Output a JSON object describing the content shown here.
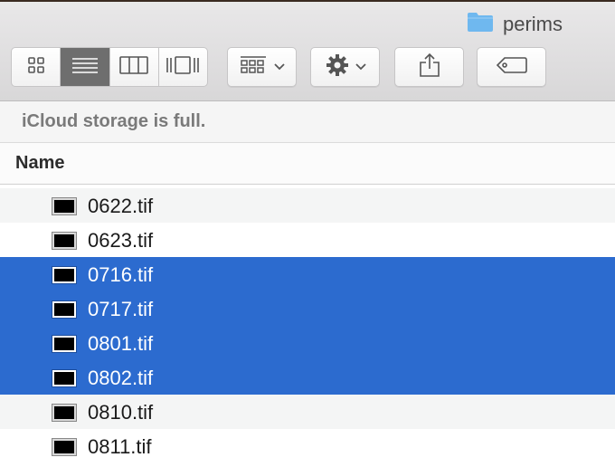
{
  "window": {
    "title": "perims",
    "title_icon": "folder-icon"
  },
  "toolbar": {
    "view_modes": [
      {
        "name": "icon-view",
        "icon": "grid-icon",
        "active": false
      },
      {
        "name": "list-view",
        "icon": "list-icon",
        "active": true
      },
      {
        "name": "column-view",
        "icon": "columns-icon",
        "active": false
      },
      {
        "name": "cover-flow-view",
        "icon": "coverflow-icon",
        "active": false
      }
    ],
    "arrange_icon": "arrange-icon",
    "action_icon": "gear-icon",
    "share_icon": "share-icon",
    "tags_icon": "tag-icon"
  },
  "banner": {
    "text": "iCloud storage is full."
  },
  "list": {
    "column_header": "Name",
    "files": [
      {
        "name": "0622.tif",
        "selected": false
      },
      {
        "name": "0623.tif",
        "selected": false
      },
      {
        "name": "0716.tif",
        "selected": true
      },
      {
        "name": "0717.tif",
        "selected": true
      },
      {
        "name": "0801.tif",
        "selected": true
      },
      {
        "name": "0802.tif",
        "selected": true
      },
      {
        "name": "0810.tif",
        "selected": false
      },
      {
        "name": "0811.tif",
        "selected": false
      }
    ]
  },
  "colors": {
    "selection": "#2c6bcf",
    "folder": "#6fb8ef"
  }
}
